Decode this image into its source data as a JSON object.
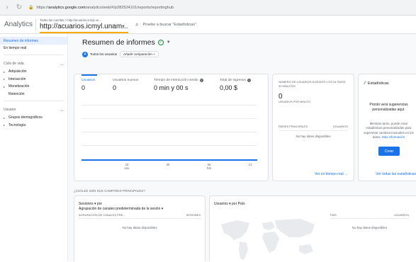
{
  "browser": {
    "url_prefix": "https://",
    "url_host": "analytics.google.com",
    "url_path": "/analytics/web/#/p282524101/reports/reportinghub"
  },
  "appbar": {
    "app_name": "Analytics",
    "account_crumb": "Todas las cuentas > http://acuarios.icmyl.un...",
    "property": "http://acuarios.icmyl.unam...",
    "search_placeholder": "Pruebe a buscar \"Estadísticas\""
  },
  "sidebar": {
    "overview": "Resumen de informes",
    "realtime": "En tiempo real",
    "lifecycle_head": "Ciclo de vida",
    "lifecycle_items": [
      "Adquisición",
      "Interacción",
      "Monetización"
    ],
    "retention": "Retención",
    "user_head": "Usuario",
    "user_items": [
      "Grupos demográficos",
      "Tecnología"
    ]
  },
  "main": {
    "title": "Resumen de informes",
    "chip_all_users": "Todos los usuarios",
    "chip_compare": "Añadir comparación +",
    "metrics": [
      {
        "label": "Usuarios",
        "value": "0"
      },
      {
        "label": "Usuarios nuevos",
        "value": "0"
      },
      {
        "label": "Tiempo de interacción medio",
        "value": "0 min y 00 s"
      },
      {
        "label": "Total de ingresos",
        "value": "0,00 $"
      }
    ],
    "x_ticks": [
      {
        "day": "23",
        "month": "ene"
      },
      {
        "day": "30",
        "month": ""
      },
      {
        "day": "06",
        "month": "feb"
      },
      {
        "day": "13",
        "month": ""
      }
    ],
    "realtime_card": {
      "heading": "NÚMERO DE USUARIOS DURANTE LOS ÚLTIMOS 30 MINUTOS",
      "value": "0",
      "sub": "USUARIOS POR MINUTO",
      "col_left": "PAÍSES PRINCIPALES",
      "col_right": "USUARIOS",
      "empty": "No hay datos disponibles",
      "link": "Ver en tiempo real →"
    },
    "insights_card": {
      "heading": "Estadísticas",
      "title": "Pronto verá sugerencias personalizadas aquí.",
      "text": "Mientras tanto, puede crear estadísticas personalizadas para supervisar cambios inusuales en los datos.",
      "link_inline": "Más información",
      "button": "Crear",
      "link": "Ver todas las estadísticas"
    },
    "section_title": "¿CUÁLES SON SUS CAMPAÑAS PRINCIPALES?",
    "campaigns_card": {
      "line1": "Sesiones ▾  por",
      "line2": "Agrupación de canales predeterminada de la sesión ▾",
      "col_left": "AGRUPACIÓN DE CANALES PRE...",
      "col_right": "SESIONES",
      "empty": "No hay datos disponibles"
    },
    "country_card": {
      "line1": "Usuarios ▾  por País",
      "col_left": "PAÍS",
      "col_right": "USUARIOS",
      "empty": "No hay datos disponibles"
    }
  },
  "colors": {
    "accent": "#1a73e8",
    "highlight": "#f9ab00",
    "success": "#188038"
  }
}
